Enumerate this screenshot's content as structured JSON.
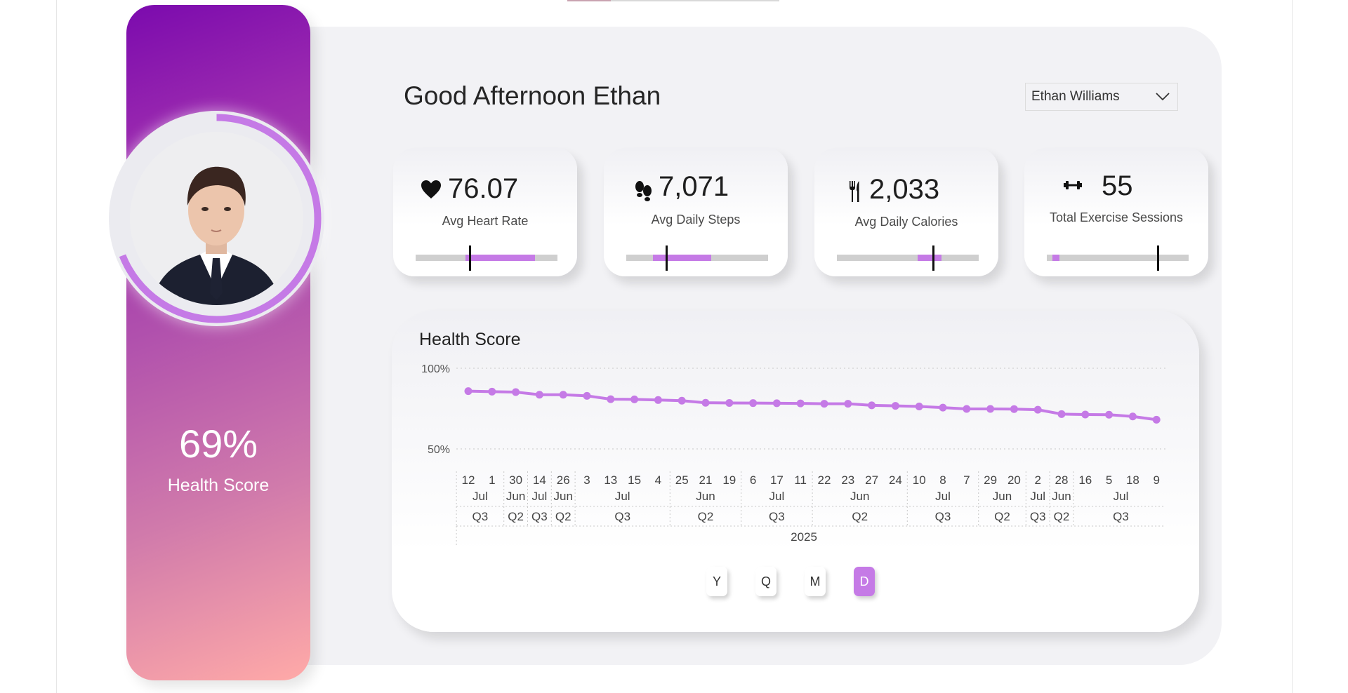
{
  "greeting": "Good Afternoon Ethan",
  "user_select": {
    "value": "Ethan Williams",
    "icon": "chevron-down-icon"
  },
  "profile": {
    "health_score_value": "69%",
    "health_score_label": "Health Score",
    "health_score_fraction": 0.69,
    "ring_color": "#c57ae6"
  },
  "kpis": [
    {
      "value": "76.07",
      "label": "Avg Heart Rate",
      "icon": "heart-icon",
      "fill_start": 0.35,
      "fill_end": 0.84,
      "target": 0.38
    },
    {
      "value": "7,071",
      "label": "Avg Daily Steps",
      "icon": "footprints-icon",
      "fill_start": 0.19,
      "fill_end": 0.6,
      "target": 0.28
    },
    {
      "value": "2,033",
      "label": "Avg Daily Calories",
      "icon": "fork-knife-icon",
      "fill_start": 0.57,
      "fill_end": 0.74,
      "target": 0.68
    },
    {
      "value": "55",
      "label": "Total Exercise Sessions",
      "icon": "dumbbell-icon",
      "fill_start": 0.04,
      "fill_end": 0.09,
      "target": 0.78
    }
  ],
  "chart_data": {
    "type": "line",
    "title": "Health Score",
    "y_ticks": [
      "100%",
      "50%"
    ],
    "ylim": [
      0.5,
      1.0
    ],
    "grid": true,
    "color": "#c57ae6",
    "x": [
      {
        "day": "12",
        "month": "Jul",
        "quarter": "Q3"
      },
      {
        "day": "1",
        "month": "Jul",
        "quarter": "Q3"
      },
      {
        "day": "30",
        "month": "Jun",
        "quarter": "Q2"
      },
      {
        "day": "14",
        "month": "Jul",
        "quarter": "Q3"
      },
      {
        "day": "26",
        "month": "Jun",
        "quarter": "Q2"
      },
      {
        "day": "3",
        "month": "Jul",
        "quarter": "Q3"
      },
      {
        "day": "13",
        "month": "Jul",
        "quarter": "Q3"
      },
      {
        "day": "15",
        "month": "Jul",
        "quarter": "Q3"
      },
      {
        "day": "4",
        "month": "Jul",
        "quarter": "Q3"
      },
      {
        "day": "25",
        "month": "Jun",
        "quarter": "Q2"
      },
      {
        "day": "21",
        "month": "Jun",
        "quarter": "Q2"
      },
      {
        "day": "19",
        "month": "Jun",
        "quarter": "Q2"
      },
      {
        "day": "6",
        "month": "Jul",
        "quarter": "Q3"
      },
      {
        "day": "17",
        "month": "Jul",
        "quarter": "Q3"
      },
      {
        "day": "11",
        "month": "Jul",
        "quarter": "Q3"
      },
      {
        "day": "22",
        "month": "Jun",
        "quarter": "Q2"
      },
      {
        "day": "23",
        "month": "Jun",
        "quarter": "Q2"
      },
      {
        "day": "27",
        "month": "Jun",
        "quarter": "Q2"
      },
      {
        "day": "24",
        "month": "Jun",
        "quarter": "Q2"
      },
      {
        "day": "10",
        "month": "Jul",
        "quarter": "Q3"
      },
      {
        "day": "8",
        "month": "Jul",
        "quarter": "Q3"
      },
      {
        "day": "7",
        "month": "Jul",
        "quarter": "Q3"
      },
      {
        "day": "29",
        "month": "Jun",
        "quarter": "Q2"
      },
      {
        "day": "20",
        "month": "Jun",
        "quarter": "Q2"
      },
      {
        "day": "2",
        "month": "Jul",
        "quarter": "Q3"
      },
      {
        "day": "28",
        "month": "Jun",
        "quarter": "Q2"
      },
      {
        "day": "16",
        "month": "Jul",
        "quarter": "Q3"
      },
      {
        "day": "5",
        "month": "Jul",
        "quarter": "Q3"
      },
      {
        "day": "18",
        "month": "Jul",
        "quarter": "Q3"
      },
      {
        "day": "9",
        "month": "Jul",
        "quarter": "Q3"
      }
    ],
    "values": [
      0.858,
      0.855,
      0.852,
      0.836,
      0.836,
      0.829,
      0.808,
      0.807,
      0.803,
      0.799,
      0.786,
      0.785,
      0.784,
      0.783,
      0.782,
      0.78,
      0.78,
      0.77,
      0.767,
      0.763,
      0.756,
      0.748,
      0.748,
      0.747,
      0.743,
      0.716,
      0.713,
      0.712,
      0.701,
      0.681
    ],
    "month_groups": [
      {
        "label": "Jul",
        "span": 2
      },
      {
        "label": "Jun",
        "span": 1
      },
      {
        "label": "Jul",
        "span": 1
      },
      {
        "label": "Jun",
        "span": 1
      },
      {
        "label": "Jul",
        "span": 4
      },
      {
        "label": "Jun",
        "span": 3
      },
      {
        "label": "Jul",
        "span": 3
      },
      {
        "label": "Jun",
        "span": 4
      },
      {
        "label": "Jul",
        "span": 3
      },
      {
        "label": "Jun",
        "span": 2
      },
      {
        "label": "Jul",
        "span": 1
      },
      {
        "label": "Jun",
        "span": 1
      },
      {
        "label": "Jul",
        "span": 4
      }
    ],
    "quarter_groups": [
      {
        "label": "Q3",
        "span": 2
      },
      {
        "label": "Q2",
        "span": 1
      },
      {
        "label": "Q3",
        "span": 1
      },
      {
        "label": "Q2",
        "span": 1
      },
      {
        "label": "Q3",
        "span": 4
      },
      {
        "label": "Q2",
        "span": 3
      },
      {
        "label": "Q3",
        "span": 3
      },
      {
        "label": "Q2",
        "span": 4
      },
      {
        "label": "Q3",
        "span": 3
      },
      {
        "label": "Q2",
        "span": 2
      },
      {
        "label": "Q3",
        "span": 1
      },
      {
        "label": "Q2",
        "span": 1
      },
      {
        "label": "Q3",
        "span": 4
      }
    ],
    "year_label": "2025"
  },
  "period_buttons": [
    {
      "label": "Y",
      "active": false
    },
    {
      "label": "Q",
      "active": false
    },
    {
      "label": "M",
      "active": false
    },
    {
      "label": "D",
      "active": true
    }
  ]
}
